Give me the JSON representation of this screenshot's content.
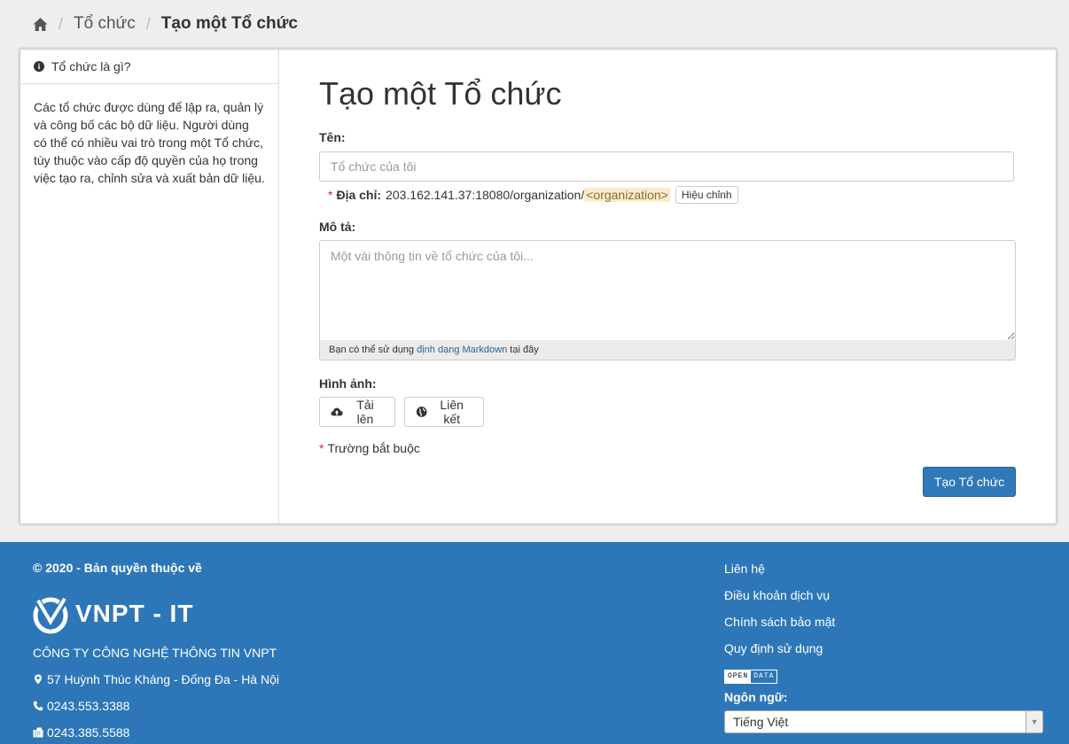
{
  "breadcrumb": {
    "home_icon": "home-icon",
    "items": [
      "Tổ chức",
      "Tạo một Tổ chức"
    ],
    "separator": "/"
  },
  "aside": {
    "heading": "Tổ chức là gì?",
    "body": "Các tổ chức được dùng để lập ra, quản lý và công bố các bộ dữ liệu. Người dùng có thể có nhiều vai trò trong một Tổ chức, tùy thuộc vào cấp độ quyền của họ trong việc tạo ra, chỉnh sửa và xuất bản dữ liệu."
  },
  "form": {
    "title": "Tạo một Tổ chức",
    "name_label": "Tên:",
    "name_placeholder": "Tổ chức của tôi",
    "name_value": "",
    "url_required": "*",
    "url_label": "Địa chỉ:",
    "url_prefix": "203.162.141.37:18080/organization/",
    "url_slug": "<organization>",
    "url_edit": "Hiệu chỉnh",
    "desc_label": "Mô tả:",
    "desc_placeholder": "Một vài thông tin về tổ chức của tôi...",
    "desc_value": "",
    "md_before": "Bạn có thể sử dụng",
    "md_link": "định dạng Markdown",
    "md_after": "tại đây",
    "image_label": "Hình ảnh:",
    "upload_btn": "Tải lên",
    "link_btn": "Liên kết",
    "required_mark": "*",
    "required_note": "Trường bắt buộc",
    "submit": "Tạo Tổ chức"
  },
  "footer": {
    "copyright": "© 2020 - Bản quyền thuộc về",
    "logo_text": "VNPT - IT",
    "company": "CÔNG TY CÔNG NGHỆ THÔNG TIN VNPT",
    "address": "57 Huỳnh Thúc Kháng - Đống Đa - Hà Nội",
    "phone": "0243.553.3388",
    "fax": "0243.385.5588",
    "links": [
      "Liên hệ",
      "Điều khoản dịch vụ",
      "Chính sách bảo mật",
      "Quy định sử dụng"
    ],
    "badge_a": "OPEN",
    "badge_b": "DATA",
    "language_label": "Ngôn ngữ:",
    "language_value": "Tiếng Việt"
  },
  "colors": {
    "footer_bg": "#2d77b8",
    "primary_button": "#2f79b8",
    "slug_highlight": "#faebcc",
    "required": "#c6303e"
  }
}
